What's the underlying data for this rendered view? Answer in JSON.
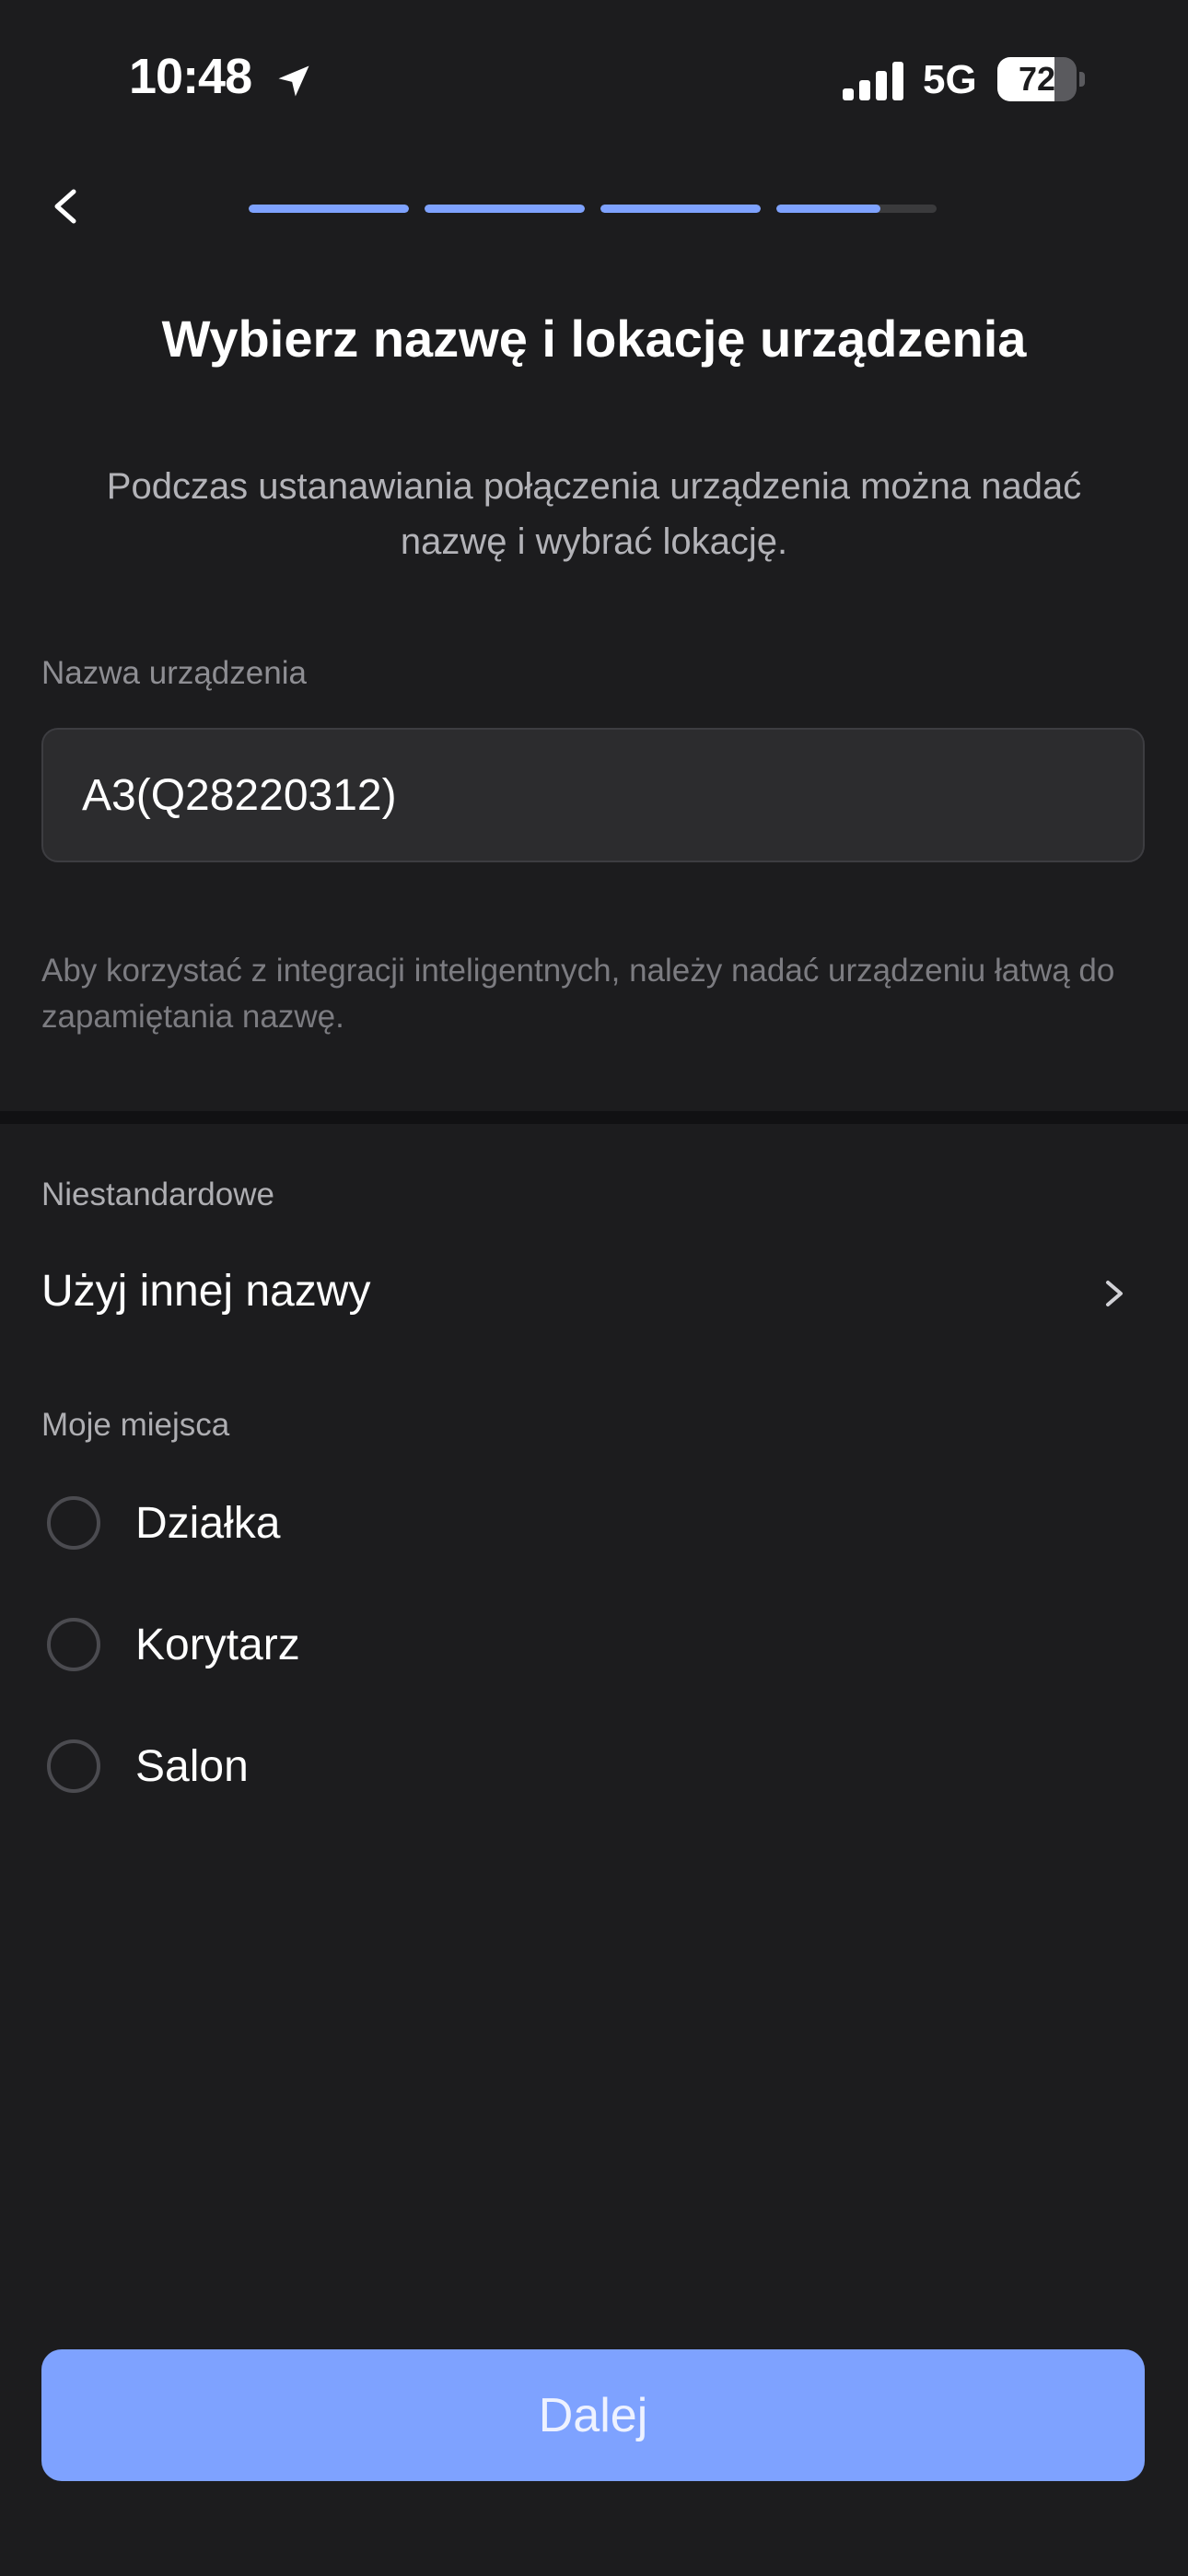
{
  "status_bar": {
    "time": "10:48",
    "network": "5G",
    "battery_percent": "72",
    "battery_level": 0.72
  },
  "progress": {
    "segments": [
      1,
      1,
      1,
      0.65
    ],
    "accent_color": "#7ea2ff"
  },
  "header": {
    "title": "Wybierz nazwę i lokację urządzenia",
    "subtitle": "Podczas ustanawiania połączenia urządzenia można nadać nazwę i wybrać lokację."
  },
  "device_name": {
    "label": "Nazwa urządzenia",
    "value": "A3(Q28220312)",
    "hint": "Aby korzystać z integracji inteligentnych, należy nadać urządzeniu łatwą do zapamiętania nazwę."
  },
  "custom": {
    "section_label": "Niestandardowe",
    "row_label": "Użyj innej nazwy"
  },
  "places": {
    "section_label": "Moje miejsca",
    "items": [
      {
        "label": "Działka",
        "selected": false
      },
      {
        "label": "Korytarz",
        "selected": false
      },
      {
        "label": "Salon",
        "selected": false
      }
    ]
  },
  "footer": {
    "next_label": "Dalej"
  },
  "icons": {
    "back": "chevron-left-icon",
    "location": "location-arrow-icon",
    "signal": "signal-bars-icon",
    "battery": "battery-icon",
    "row_arrow": "chevron-right-icon",
    "radio": "radio-unchecked-icon"
  }
}
